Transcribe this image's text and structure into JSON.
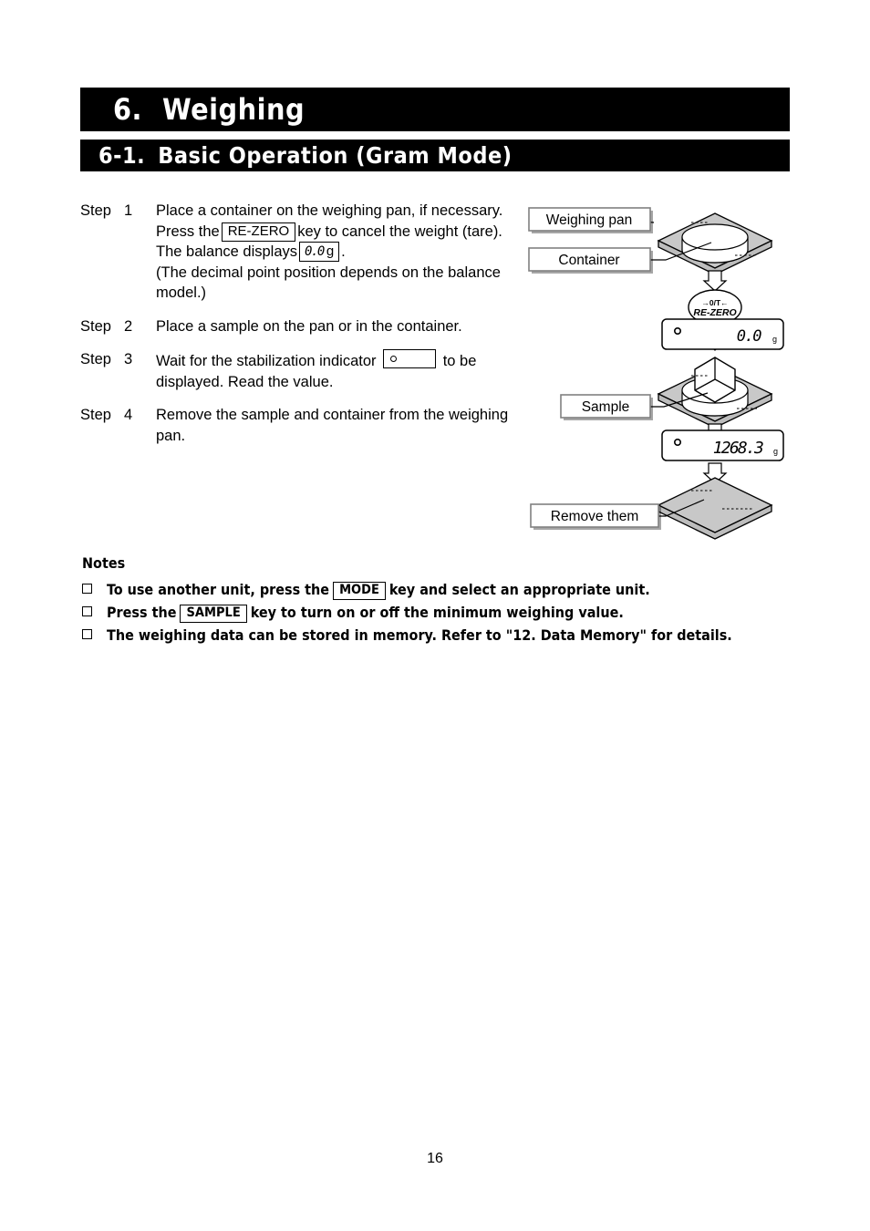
{
  "chapter": {
    "number": "6.",
    "title": "Weighing"
  },
  "section": {
    "number": "6-1.",
    "title": "Basic Operation (Gram Mode)"
  },
  "steps": [
    {
      "label": "Step",
      "number": "1",
      "text_a": "Place a container on the weighing pan, if necessary.",
      "text_b": "Press the",
      "key": "RE-ZERO",
      "text_c": "key to cancel the weight (tare). The balance displays",
      "lcd_value": "0.0",
      "lcd_unit": "g",
      "text_d": ".",
      "text_e": "(The decimal point position depends on the balance model.)"
    },
    {
      "label": "Step",
      "number": "2",
      "text_a": "Place a sample on the pan or in the container."
    },
    {
      "label": "Step",
      "number": "3",
      "text_a": "Wait for the stabilization indicator",
      "text_b": "to be displayed. Read the value."
    },
    {
      "label": "Step",
      "number": "4",
      "text_a": "Remove the sample and container from the weighing pan."
    }
  ],
  "notes": {
    "title": "Notes",
    "items": [
      {
        "text_a": "To use another unit, press the",
        "key": "MODE",
        "text_b": "key and select an appropriate unit."
      },
      {
        "text_a": "Press the",
        "key": "SAMPLE",
        "text_b": "key to turn on or off the minimum weighing value."
      },
      {
        "text_a": "The weighing data can be stored in memory. Refer to \"12. Data Memory\" for details.",
        "key": "",
        "text_b": ""
      }
    ]
  },
  "diagram": {
    "callouts": {
      "weighing_pan": "Weighing pan",
      "container": "Container",
      "sample": "Sample",
      "remove_them": "Remove them"
    },
    "rezero_button": {
      "top_label": "→0/T←",
      "main_label": "RE-ZERO"
    },
    "displays": [
      {
        "value": "0.0",
        "unit": "g",
        "stable_indicator": "○"
      },
      {
        "value": "1268.3",
        "unit": "g",
        "stable_indicator": "○"
      }
    ],
    "colors": {
      "pan_fill": "#c8c8c8",
      "pan_stroke": "#000000",
      "callout_border": "#808080"
    }
  },
  "page_number": "16"
}
